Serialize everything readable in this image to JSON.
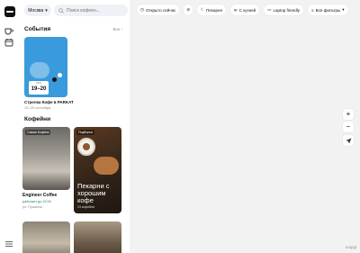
{
  "header": {
    "city": "Москва",
    "search_placeholder": "Поиск кофеен..."
  },
  "events": {
    "title": "События",
    "all_link": "Все",
    "items": [
      {
        "name": "Стрелка Кофе в PARKAT",
        "date": "19–20 сентября",
        "badge_month": "сен",
        "badge_days": "19–20"
      }
    ]
  },
  "coffee": {
    "title": "Кофейни",
    "items": [
      {
        "tag": "Самая Кофеня",
        "name": "Engineer Coffee",
        "hours": "работает до 22:00",
        "address": "ул. Пушкина"
      },
      {
        "tag": "Подборка",
        "promo_title": "Пекарни с хорошим кофе",
        "promo_count": "23 кофейни"
      },
      {
        "tag": ""
      },
      {
        "tag": ""
      }
    ]
  },
  "filters": [
    {
      "label": "Открыто сейчас",
      "icon": "clock-icon"
    },
    {
      "label": "",
      "icon": "no-smoking-icon"
    },
    {
      "label": "Пекарня",
      "icon": "croissant-icon"
    },
    {
      "label": "С кухней",
      "icon": "fork-knife-icon"
    },
    {
      "label": "Laptop friendly",
      "icon": "laptop-icon"
    },
    {
      "label": "Все фильтры",
      "icon": "sliders-icon"
    }
  ],
  "map": {
    "zoom_in": "+",
    "zoom_out": "−",
    "attribution": "mapgl"
  },
  "colors": {
    "accent_blue": "#3a9bdc",
    "open_green": "#1a8a4a"
  }
}
